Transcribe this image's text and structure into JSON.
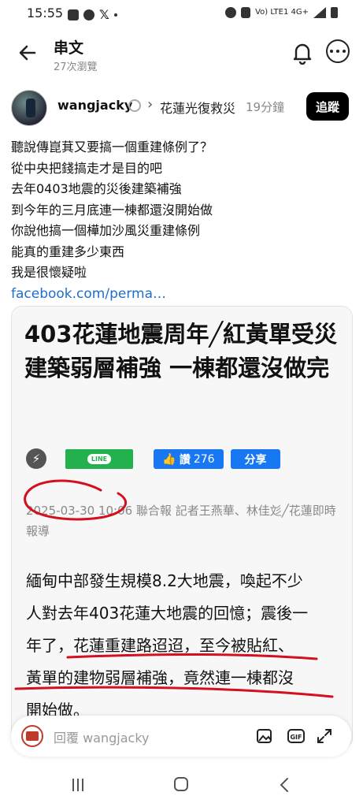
{
  "status_bar": {
    "time": "15:55",
    "network": "Vo) LTE1 4G+"
  },
  "header": {
    "title": "串文",
    "views": "27次瀏覽"
  },
  "post": {
    "username": "wangjacky",
    "community": "花蓮光復救災",
    "time_ago": "19分鐘",
    "follow_label": "追蹤",
    "lines": [
      "聽說傳崑萁又要搞一個重建條例了？",
      "從中央把錢搞走才是目的吧",
      "去年0403地震的災後建築補強",
      "到今年的三月底連一棟都還沒開始做",
      "你說他搞一個樺加沙風災重建條例",
      "能真的重建多少東西",
      "我是很懷疑啦"
    ],
    "link": "facebook.com/perma…"
  },
  "article": {
    "headline": "403花蓮地震周年╱紅黃單受災建築弱層補強 一棟都還沒做完",
    "line_label": "LINE",
    "like_label": "讚",
    "like_count": "276",
    "share_label": "分享",
    "byline": "2025-03-30 10:06 聯合報 記者王燕華、林佳彣╱花蓮即時報導",
    "paragraph_lines": [
      "緬甸中部發生規模8.2大地震，喚起不少",
      "人對去年403花蓮大地震的回憶；震後一",
      "年了，花蓮重建路迢迢，至今被貼紅、",
      "黃單的建物弱層補強，竟然連一棟都沒",
      "開始做。"
    ]
  },
  "reply": {
    "placeholder": "回覆 wangjacky"
  },
  "icons": {
    "back": "arrow-left-icon",
    "bell": "bell-icon",
    "more": "more-horizontal-icon",
    "gallery": "image-icon",
    "gif": "gif-icon",
    "expand": "expand-icon"
  },
  "colors": {
    "link": "#1d6fc8",
    "facebook_blue": "#1877f2",
    "line_green": "#22b14c",
    "annotation_red": "#d40f1e"
  }
}
